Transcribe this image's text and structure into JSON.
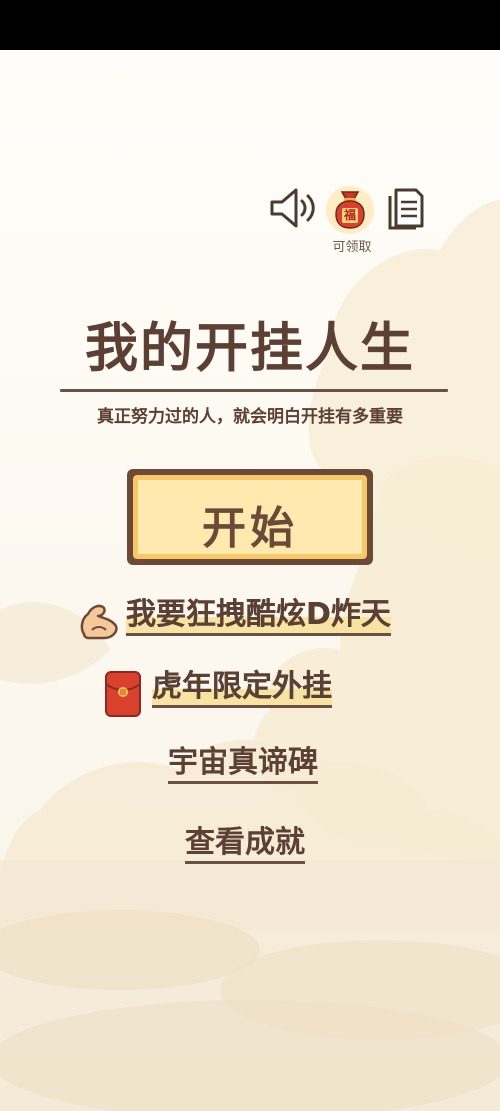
{
  "header": {
    "claim_label": "可领取",
    "bag_char": "福"
  },
  "title": "我的开挂人生",
  "subtitle": "真正努力过的人，就会明白开挂有多重要",
  "start_button": {
    "label": "开始"
  },
  "menu": {
    "shout": "我要狂拽酷炫D炸天",
    "tiger": "虎年限定外挂",
    "universe": "宇宙真谛碑",
    "achievements": "查看成就"
  },
  "colors": {
    "brown": "#5c4033",
    "button_face": "#ffe9ae",
    "button_border": "#6b4a38",
    "accent_red": "#d9412f"
  },
  "icons": [
    "speaker-icon",
    "fortune-bag-icon",
    "document-icon",
    "muscle-arm-icon",
    "red-envelope-icon"
  ]
}
